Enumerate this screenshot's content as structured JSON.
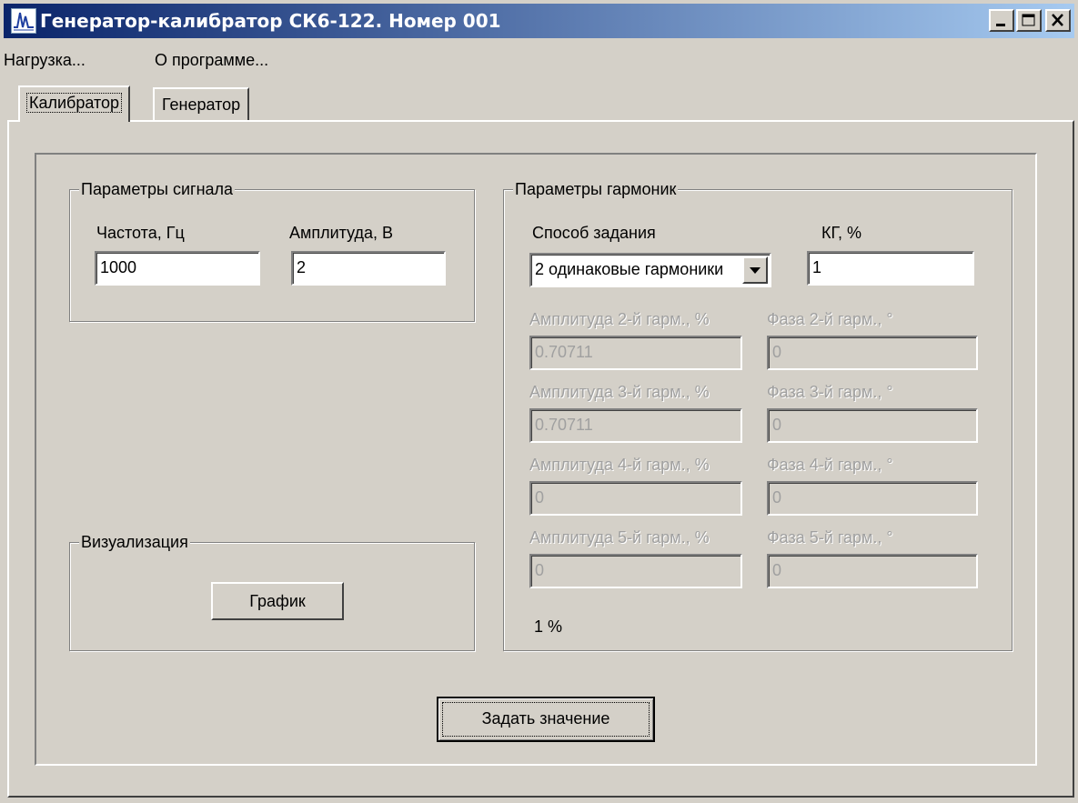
{
  "window": {
    "title": "Генератор-калибратор СК6-122. Номер 001"
  },
  "menu": [
    {
      "label": "Нагрузка..."
    },
    {
      "label": "О программе..."
    }
  ],
  "tabs": [
    {
      "label": "Калибратор",
      "active": true
    },
    {
      "label": "Генератор",
      "active": false
    }
  ],
  "signal": {
    "group_title": "Параметры сигнала",
    "frequency_label": "Частота, Гц",
    "frequency_value": "1000",
    "amplitude_label": "Амплитуда, В",
    "amplitude_value": "2"
  },
  "harmonics": {
    "group_title": "Параметры гармоник",
    "method_label": "Способ задания",
    "method_value": "2 одинаковые гармоники",
    "kg_label": "КГ, %",
    "kg_value": "1",
    "rows": [
      {
        "amp_label": "Амплитуда 2-й гарм., %",
        "amp_value": "0.70711",
        "phase_label": "Фаза 2-й гарм., °",
        "phase_value": "0"
      },
      {
        "amp_label": "Амплитуда 3-й гарм., %",
        "amp_value": "0.70711",
        "phase_label": "Фаза 3-й гарм., °",
        "phase_value": "0"
      },
      {
        "amp_label": "Амплитуда 4-й гарм., %",
        "amp_value": "0",
        "phase_label": "Фаза 4-й гарм., °",
        "phase_value": "0"
      },
      {
        "amp_label": "Амплитуда 5-й гарм., %",
        "amp_value": "0",
        "phase_label": "Фаза 5-й гарм., °",
        "phase_value": "0"
      }
    ],
    "result_text": "1 %"
  },
  "visualization": {
    "group_title": "Визуализация",
    "graph_button": "График"
  },
  "apply_button": "Задать значение",
  "colors": {
    "face": "#d4d0c8",
    "title_start": "#0a246a",
    "title_end": "#a6caf0",
    "disabled_text": "#a0a0a0"
  }
}
